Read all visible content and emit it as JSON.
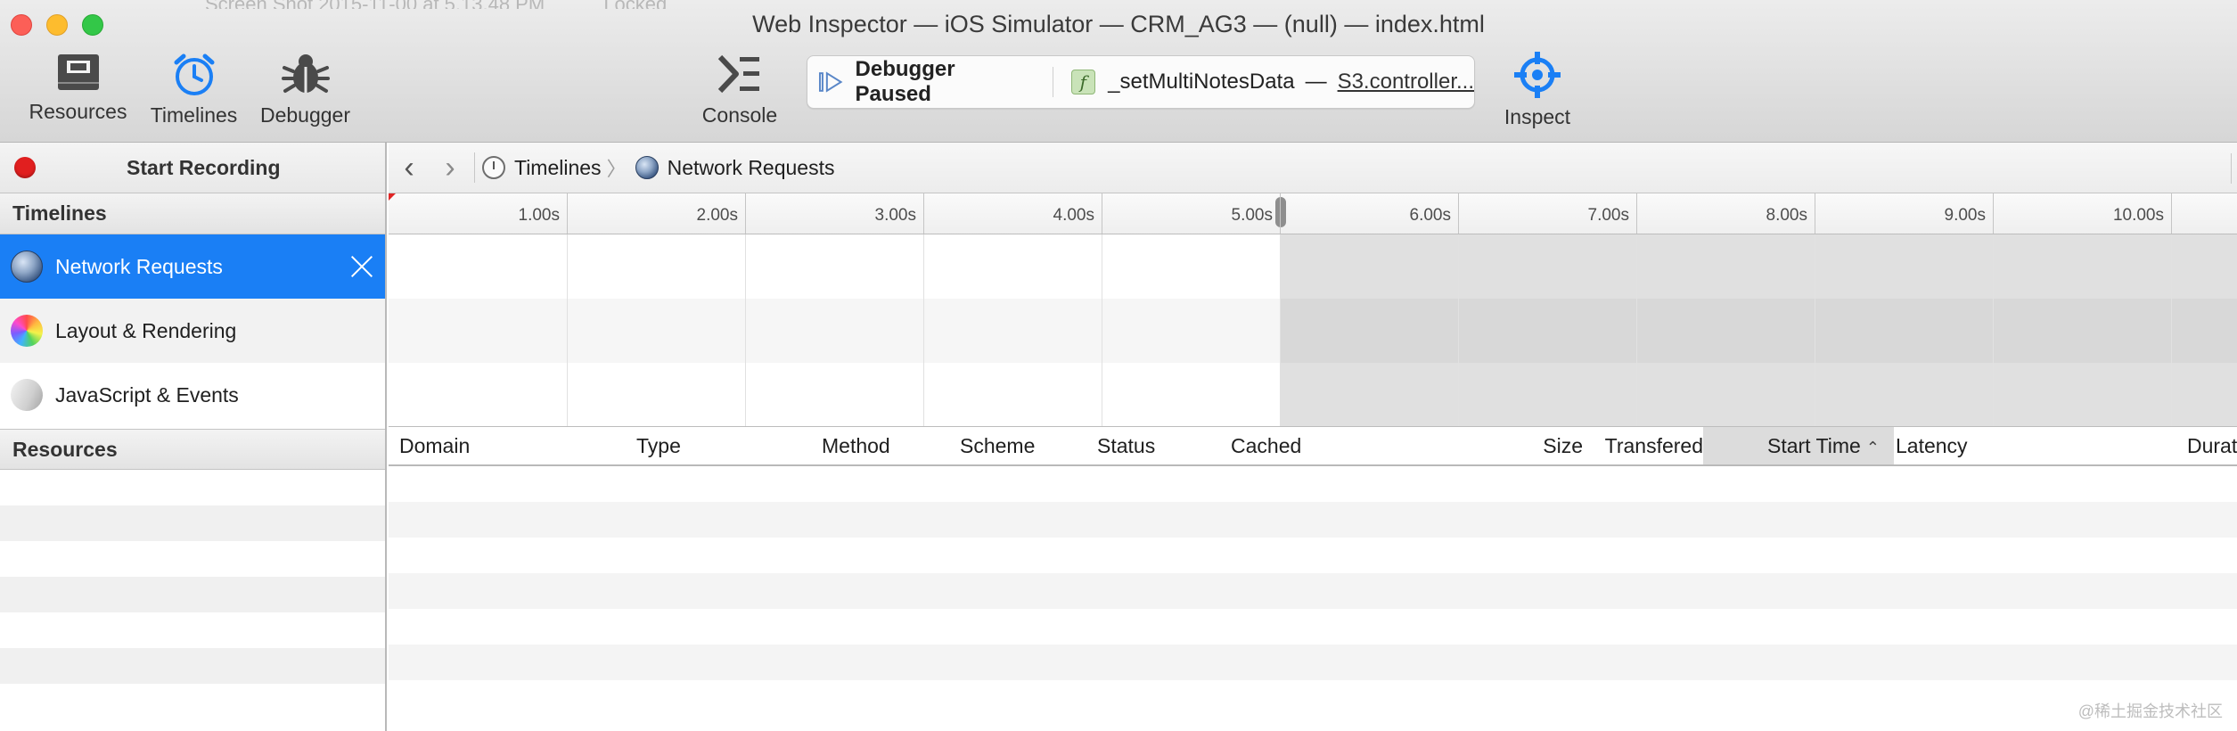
{
  "window": {
    "title": "Web Inspector — iOS Simulator — CRM_AG3 — (null) — index.html",
    "ghost_tabs": [
      "Screen Shot 2015-11-00 at 5.13.48 PM",
      "Locked"
    ]
  },
  "toolbar": {
    "resources_label": "Resources",
    "timelines_label": "Timelines",
    "debugger_label": "Debugger",
    "console_label": "Console",
    "inspect_label": "Inspect",
    "accent_color": "#1a7ff5"
  },
  "dashboard": {
    "status": "Debugger Paused",
    "function_badge": "f",
    "function_name": "_setMultiNotesData",
    "separator": "—",
    "source_file": "S3.controller..."
  },
  "sidebar": {
    "record_label": "Start Recording",
    "timelines_header": "Timelines",
    "timelines": [
      {
        "label": "Network Requests",
        "icon": "globe-icon",
        "selected": true
      },
      {
        "label": "Layout & Rendering",
        "icon": "color-wheel-icon",
        "selected": false
      },
      {
        "label": "JavaScript & Events",
        "icon": "script-icon",
        "selected": false
      }
    ],
    "resources_header": "Resources"
  },
  "navbar": {
    "breadcrumbs": [
      {
        "label": "Timelines",
        "icon": "stopwatch-icon"
      },
      {
        "label": "Network Requests",
        "icon": "globe-icon"
      }
    ]
  },
  "ruler": {
    "ticks": [
      "1.00s",
      "2.00s",
      "3.00s",
      "4.00s",
      "5.00s",
      "6.00s",
      "7.00s",
      "8.00s",
      "9.00s",
      "10.00s"
    ],
    "selection_end": "5.00s"
  },
  "table": {
    "columns": [
      "Domain",
      "Type",
      "Method",
      "Scheme",
      "Status",
      "Cached",
      "Size",
      "Transfered",
      "Start Time",
      "Latency",
      "Durat"
    ],
    "sorted_column": "Start Time",
    "sort_direction": "ascending"
  },
  "watermark": "@稀土掘金技术社区"
}
